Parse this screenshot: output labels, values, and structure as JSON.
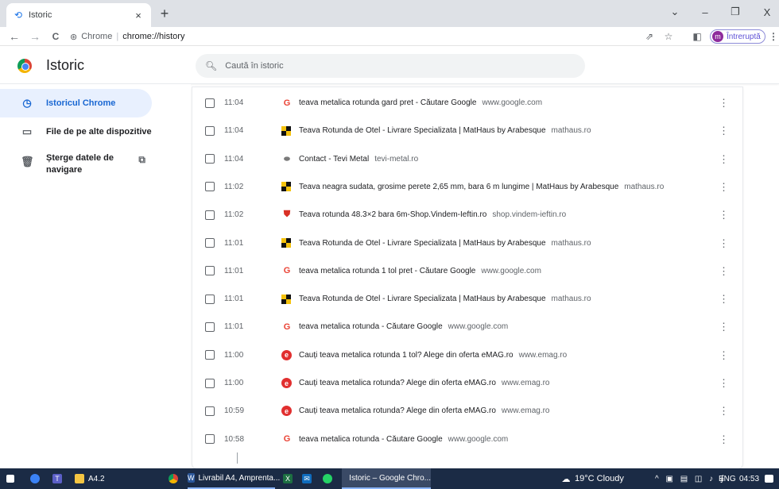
{
  "tab": {
    "title": "Istoric",
    "close": "×",
    "new": "+"
  },
  "window": {
    "minimize": "–",
    "restore": "❐",
    "close": "X",
    "menu": "⌄"
  },
  "toolbar": {
    "back": "←",
    "forward": "→",
    "reload": "C",
    "site_label": "Chrome",
    "url": "chrome://history",
    "profile_initial": "m",
    "profile_status": "Întreruptă"
  },
  "header": {
    "title": "Istoric",
    "search_placeholder": "Caută în istoric"
  },
  "sidebar": {
    "items": [
      {
        "label": "Istoricul Chrome",
        "icon": "clock-icon"
      },
      {
        "label": "File de pe alte dispozitive",
        "icon": "devices-icon"
      },
      {
        "label": "Șterge datele de navigare",
        "icon": "trash-icon",
        "external": "open-external-icon"
      }
    ]
  },
  "history": [
    {
      "time": "11:04",
      "icon": "google",
      "title": "teava metalica rotunda gard pret - Căutare Google",
      "domain": "www.google.com"
    },
    {
      "time": "11:04",
      "icon": "mathaus",
      "title": "Teava Rotunda de Otel - Livrare Specializata | MatHaus by Arabesque",
      "domain": "mathaus.ro"
    },
    {
      "time": "11:04",
      "icon": "tevi",
      "title": "Contact - Tevi Metal",
      "domain": "tevi-metal.ro"
    },
    {
      "time": "11:02",
      "icon": "mathaus",
      "title": "Teava neagra sudata, grosime perete 2,65 mm, bara 6 m lungime | MatHaus by Arabesque",
      "domain": "mathaus.ro"
    },
    {
      "time": "11:02",
      "icon": "vindem",
      "title": "Teava rotunda 48.3×2 bara 6m-Shop.Vindem-Ieftin.ro",
      "domain": "shop.vindem-ieftin.ro"
    },
    {
      "time": "11:01",
      "icon": "mathaus",
      "title": "Teava Rotunda de Otel - Livrare Specializata | MatHaus by Arabesque",
      "domain": "mathaus.ro"
    },
    {
      "time": "11:01",
      "icon": "google",
      "title": "teava metalica rotunda 1 tol pret - Căutare Google",
      "domain": "www.google.com"
    },
    {
      "time": "11:01",
      "icon": "mathaus",
      "title": "Teava Rotunda de Otel - Livrare Specializata | MatHaus by Arabesque",
      "domain": "mathaus.ro"
    },
    {
      "time": "11:01",
      "icon": "google",
      "title": "teava metalica rotunda - Căutare Google",
      "domain": "www.google.com"
    },
    {
      "time": "11:00",
      "icon": "emag",
      "title": "Cauți teava metalica rotunda 1 tol? Alege din oferta eMAG.ro",
      "domain": "www.emag.ro"
    },
    {
      "time": "11:00",
      "icon": "emag",
      "title": "Cauți teava metalica rotunda? Alege din oferta eMAG.ro",
      "domain": "www.emag.ro"
    },
    {
      "time": "10:59",
      "icon": "emag",
      "title": "Cauți teava metalica rotunda? Alege din oferta eMAG.ro",
      "domain": "www.emag.ro"
    },
    {
      "time": "10:58",
      "icon": "google",
      "title": "teava metalica rotunda - Căutare Google",
      "domain": "www.google.com"
    }
  ],
  "taskbar": {
    "folder_label": "A4.2",
    "word_label": "Livrabil A4, Amprenta...",
    "chrome_label": "Istoric – Google Chro...",
    "weather": "19°C  Cloudy",
    "lang": "ENG",
    "clock": "04:53"
  },
  "colors": {
    "accent": "#1967d2",
    "active_bg": "#e8f0fe",
    "taskbar": "#1b2b45"
  }
}
